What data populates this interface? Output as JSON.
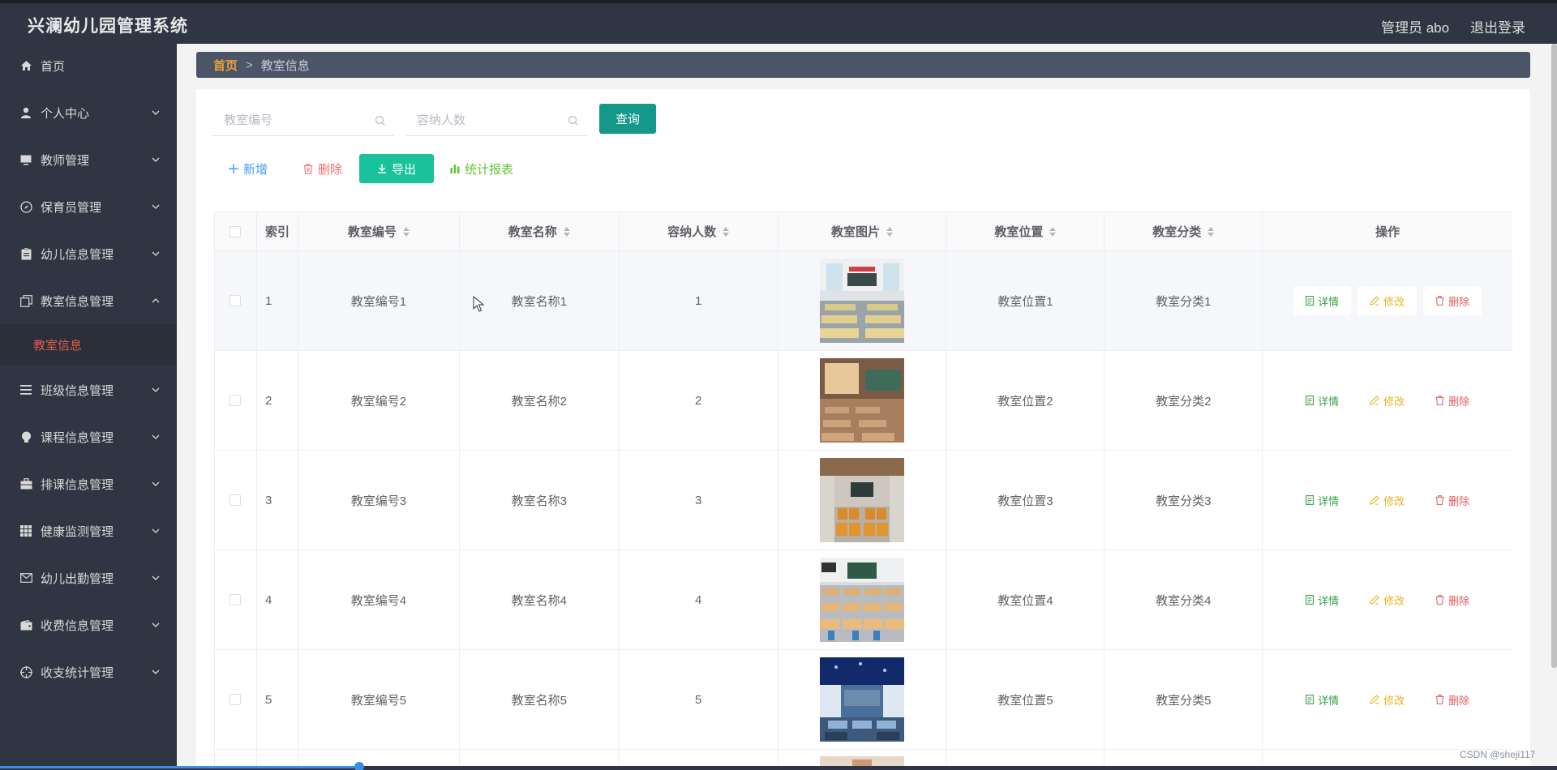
{
  "app": {
    "title": "兴澜幼儿园管理系统",
    "admin_label": "管理员 abo",
    "logout_label": "退出登录"
  },
  "sidebar": {
    "items": [
      {
        "label": "首页",
        "icon": "home-icon",
        "has_arrow": false
      },
      {
        "label": "个人中心",
        "icon": "user-icon",
        "has_arrow": true
      },
      {
        "label": "教师管理",
        "icon": "monitor-icon",
        "has_arrow": true
      },
      {
        "label": "保育员管理",
        "icon": "compass-icon",
        "has_arrow": true
      },
      {
        "label": "幼儿信息管理",
        "icon": "clipboard-icon",
        "has_arrow": true
      },
      {
        "label": "教室信息管理",
        "icon": "copy-icon",
        "has_arrow": true,
        "expanded": true
      },
      {
        "label": "班级信息管理",
        "icon": "list-icon",
        "has_arrow": true
      },
      {
        "label": "课程信息管理",
        "icon": "bulb-icon",
        "has_arrow": true
      },
      {
        "label": "排课信息管理",
        "icon": "briefcase-icon",
        "has_arrow": true
      },
      {
        "label": "健康监测管理",
        "icon": "grid-icon",
        "has_arrow": true
      },
      {
        "label": "幼儿出勤管理",
        "icon": "mail-icon",
        "has_arrow": true
      },
      {
        "label": "收费信息管理",
        "icon": "wallet-icon",
        "has_arrow": true
      },
      {
        "label": "收支统计管理",
        "icon": "crosshair-icon",
        "has_arrow": true
      }
    ],
    "submenu": {
      "label": "教室信息"
    }
  },
  "breadcrumb": {
    "home": "首页",
    "sep": ">",
    "current": "教室信息"
  },
  "search": {
    "code_placeholder": "教室编号",
    "capacity_placeholder": "容纳人数",
    "query_label": "查询"
  },
  "toolbar": {
    "add_label": "新增",
    "delete_label": "删除",
    "export_label": "导出",
    "stats_label": "统计报表"
  },
  "table": {
    "headers": {
      "index": "索引",
      "code": "教室编号",
      "name": "教室名称",
      "capacity": "容纳人数",
      "image": "教室图片",
      "location": "教室位置",
      "category": "教室分类",
      "ops": "操作"
    },
    "op_labels": {
      "detail": "详情",
      "edit": "修改",
      "delete": "删除"
    },
    "rows": [
      {
        "index": "1",
        "code": "教室编号1",
        "name": "教室名称1",
        "capacity": "1",
        "location": "教室位置1",
        "category": "教室分类1"
      },
      {
        "index": "2",
        "code": "教室编号2",
        "name": "教室名称2",
        "capacity": "2",
        "location": "教室位置2",
        "category": "教室分类2"
      },
      {
        "index": "3",
        "code": "教室编号3",
        "name": "教室名称3",
        "capacity": "3",
        "location": "教室位置3",
        "category": "教室分类3"
      },
      {
        "index": "4",
        "code": "教室编号4",
        "name": "教室名称4",
        "capacity": "4",
        "location": "教室位置4",
        "category": "教室分类4"
      },
      {
        "index": "5",
        "code": "教室编号5",
        "name": "教室名称5",
        "capacity": "5",
        "location": "教室位置5",
        "category": "教室分类5"
      }
    ]
  },
  "watermark": "CSDN @sheji117"
}
